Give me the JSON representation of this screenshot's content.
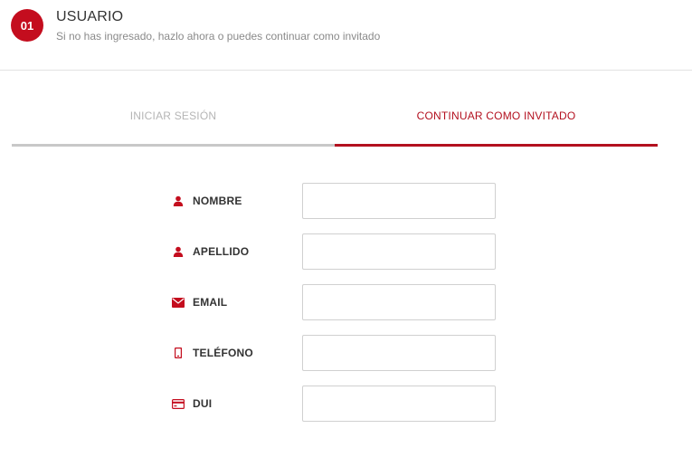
{
  "step": {
    "number": "01",
    "title": "USUARIO",
    "subtitle": "Si no has ingresado, hazlo ahora o puedes continuar como invitado"
  },
  "tabs": [
    {
      "label": "INICIAR SESIÓN",
      "active": false
    },
    {
      "label": "CONTINUAR COMO INVITADO",
      "active": true
    }
  ],
  "form": {
    "fields": [
      {
        "label": "NOMBRE",
        "icon": "user-icon",
        "value": "",
        "placeholder": ""
      },
      {
        "label": "APELLIDO",
        "icon": "user-icon",
        "value": "",
        "placeholder": ""
      },
      {
        "label": "EMAIL",
        "icon": "envelope-icon",
        "value": "",
        "placeholder": ""
      },
      {
        "label": "TELÉFONO",
        "icon": "mobile-phone-icon",
        "value": "",
        "placeholder": ""
      },
      {
        "label": "DUI",
        "icon": "id-card-icon",
        "value": "",
        "placeholder": ""
      }
    ]
  },
  "colors": {
    "accent": "#c40d1e",
    "inactive_tab": "#b5b5b5"
  }
}
